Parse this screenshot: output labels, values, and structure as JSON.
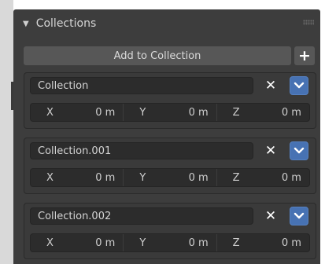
{
  "panel": {
    "title": "Collections",
    "add_label": "Add to Collection",
    "plus_label": "+"
  },
  "collections": [
    {
      "name": "Collection",
      "remove_label": "✕",
      "fields": [
        {
          "axis": "X",
          "value": "0 m"
        },
        {
          "axis": "Y",
          "value": "0 m"
        },
        {
          "axis": "Z",
          "value": "0 m"
        }
      ]
    },
    {
      "name": "Collection.001",
      "remove_label": "✕",
      "fields": [
        {
          "axis": "X",
          "value": "0 m"
        },
        {
          "axis": "Y",
          "value": "0 m"
        },
        {
          "axis": "Z",
          "value": "0 m"
        }
      ]
    },
    {
      "name": "Collection.002",
      "remove_label": "✕",
      "fields": [
        {
          "axis": "X",
          "value": "0 m"
        },
        {
          "axis": "Y",
          "value": "0 m"
        },
        {
          "axis": "Z",
          "value": "0 m"
        }
      ]
    }
  ],
  "icons": {
    "collapse": "triangle-down-icon",
    "grip": "drag-grip-icon",
    "menu": "chevron-down-icon"
  },
  "colors": {
    "panel_bg": "#3d3d3d",
    "accent": "#4772b3"
  }
}
